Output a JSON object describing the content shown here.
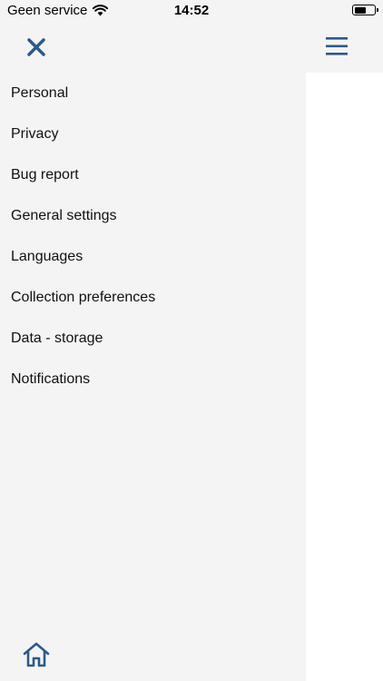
{
  "status_bar": {
    "carrier": "Geen service",
    "time": "14:52",
    "wifi_icon": "wifi-icon",
    "battery_icon": "battery-icon",
    "battery_level": 0.6
  },
  "header": {
    "close_icon": "close-icon",
    "menu_icon": "hamburger-menu-icon",
    "accent_color": "#2b5a8a"
  },
  "drawer": {
    "items": [
      {
        "label": "Personal"
      },
      {
        "label": "Privacy"
      },
      {
        "label": "Bug report"
      },
      {
        "label": "General settings"
      },
      {
        "label": "Languages"
      },
      {
        "label": "Collection preferences"
      },
      {
        "label": "Data - storage"
      },
      {
        "label": "Notifications"
      }
    ],
    "home_icon": "home-icon",
    "background_color": "#f4f4f4"
  }
}
